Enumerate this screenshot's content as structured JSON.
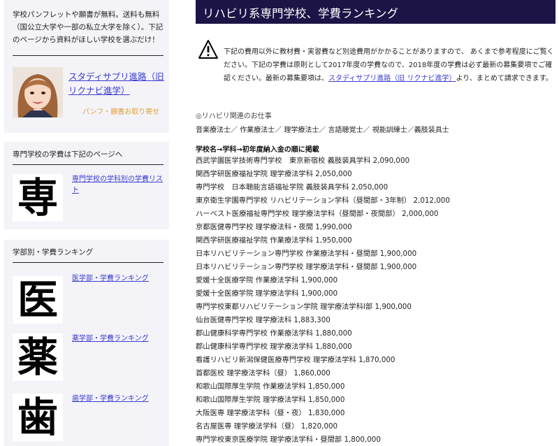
{
  "sidebar": {
    "intro": "学校パンフレットや願書が無料。送料も無料（国公立大学や一部の私立大学を除く）。下記のページから資料がほしい学校を選ぶだけ！",
    "studysapuri_link": "スタディサプリ進路（旧 リクナビ進学）",
    "pamphlet_label": "パンフ・願書お取り寄せ",
    "tuition_heading": "専門学校の学費は下記のページへ",
    "sen_kanji": "専",
    "sen_link": "専門学校の学科別の学費リスト",
    "ranking_heading": "学部別・学費ランキング",
    "faculties": [
      {
        "kanji": "医",
        "link": "医学部・学費ランキング"
      },
      {
        "kanji": "薬",
        "link": "薬学部・学費ランキング"
      },
      {
        "kanji": "歯",
        "link": "歯学部・学費ランキング"
      }
    ]
  },
  "main": {
    "title": "リハビリ系専門学校、学費ランキング",
    "notice_before": "下記の費用以外に教材費・実習費など別途費用がかかることがありますので、 あくまで参考程度にご覧ください。下記の学費は原則として2017年度の学費なので、2018年度の学費は必ず最新の募集要項でご確認ください。最新の募集要項は、",
    "notice_link": "スタディサプリ進路（旧 リクナビ進学）",
    "notice_after": "より、まとめて請求できます。",
    "jobs_heading": "◎リハビリ関連のお仕事",
    "jobs_list": "音楽療法士／ 作業療法士／ 理学療法士／ 言語聴覚士／ 視能訓練士／義肢装具士",
    "list_title": "学校名→学科→初年度納入金の順に掲載",
    "ranking": [
      "西武学園医学技術専門学校　東京新宿校 義肢装具学科 2,090,000",
      "関西学研医療福祉学院 理学療法学科 2,050,000",
      "専門学校　日本聴能言語福祉学院 義肢装具学科 2,050,000",
      "東京衛生学園専門学校 リハビリテーション学科（昼間部・3年制） 2,012,000",
      "ハーベスト医療福祉専門学校 理学療法学科（昼間部・夜間部） 2,000,000",
      "京都医健専門学校 理学療法科・夜間 1,990,000",
      "関西学研医療福祉学院 作業療法学科 1,950,000",
      "日本リハビリテーション専門学校 作業療法学科・昼間部 1,900,000",
      "日本リハビリテーション専門学校 理学療法学科・昼間部 1,900,000",
      "愛媛十全医療学院 作業療法学科 1,900,000",
      "愛媛十全医療学院 理学療法学科 1,900,000",
      "専門学校東都リハビリテーション学院 理学療法学科Ⅰ部 1,900,000",
      "仙台医健専門学校 理学療法科 1,883,300",
      "郡山健康科学専門学校 作業療法学科 1,880,000",
      "郡山健康科学専門学校 理学療法学科 1,880,000",
      "看護リハビリ新潟保健医療専門学校 理学療法学科 1,870,000",
      "首都医校 理学療法学科（昼） 1,860,000",
      "和歌山国際厚生学院 作業療法学科 1,850,000",
      "和歌山国際厚生学院 理学療法学科 1,850,000",
      "大阪医専 理学療法学科（昼・夜） 1,830,000",
      "名古屋医専 理学療法学科（昼） 1,820,000",
      "専門学校東京医療学院 理学療法学科・昼間部 1,800,000"
    ]
  },
  "icons": {
    "warning": "warning-triangle-icon"
  },
  "colors": {
    "title_bg": "#1c1346",
    "link": "#3c3cd0",
    "accent": "#e1a13a"
  }
}
